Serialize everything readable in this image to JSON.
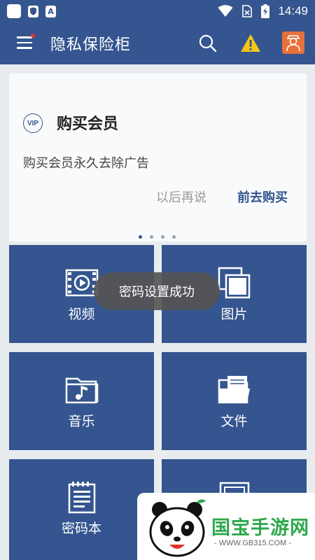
{
  "status_bar": {
    "time": "14:49",
    "icons": [
      "app-notification-icon",
      "shield-icon",
      "a-icon",
      "wifi-icon",
      "no-sim-icon",
      "battery-charging-icon"
    ]
  },
  "app_bar": {
    "title": "隐私保险柜",
    "icons": [
      "menu-icon",
      "search-icon",
      "warning-icon",
      "avatar-icon"
    ]
  },
  "vip_card": {
    "badge": "VIP",
    "title": "购买会员",
    "description": "购买会员永久去除广告",
    "later_label": "以后再说",
    "buy_label": "前去购买",
    "page_count": 4,
    "active_page": 1
  },
  "tiles": [
    {
      "label": "视频",
      "icon": "video-icon"
    },
    {
      "label": "图片",
      "icon": "image-icon"
    },
    {
      "label": "音乐",
      "icon": "music-icon"
    },
    {
      "label": "文件",
      "icon": "folder-icon"
    },
    {
      "label": "密码本",
      "icon": "notepad-icon"
    },
    {
      "label": "",
      "icon": "safe-icon"
    }
  ],
  "toast": {
    "message": "密码设置成功"
  },
  "watermark": {
    "text": "国宝手游网",
    "url": "- WWW.GB315.COM -"
  },
  "colors": {
    "primary": "#34558f",
    "toast_bg": "#555555",
    "warning": "#f5c518",
    "avatar_bg": "#e8703a",
    "watermark_green": "#2ea84d"
  }
}
